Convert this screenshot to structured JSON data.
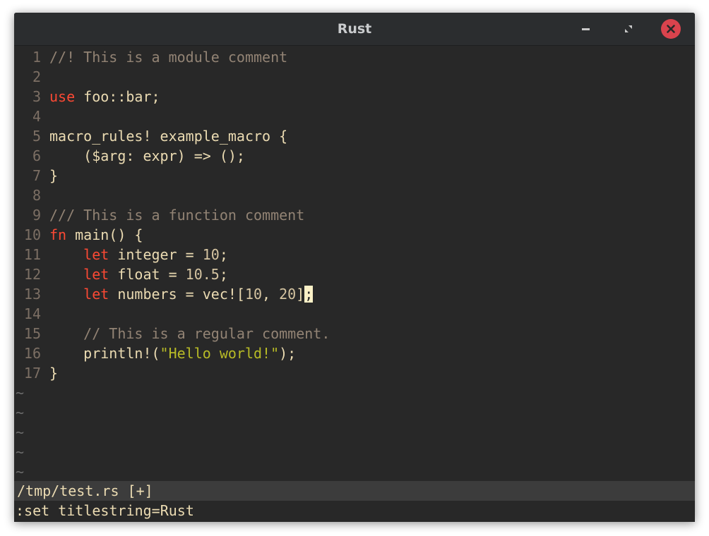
{
  "window": {
    "title": "Rust",
    "close_color": "#d9434d"
  },
  "editor": {
    "lines": [
      {
        "num": "1",
        "segments": [
          {
            "t": "//! This is a module comment",
            "c": "cm"
          }
        ]
      },
      {
        "num": "2",
        "segments": []
      },
      {
        "num": "3",
        "segments": [
          {
            "t": "use",
            "c": "kw"
          },
          {
            "t": " foo::bar;",
            "c": ""
          }
        ]
      },
      {
        "num": "4",
        "segments": []
      },
      {
        "num": "5",
        "segments": [
          {
            "t": "macro_rules! example_macro {",
            "c": ""
          }
        ]
      },
      {
        "num": "6",
        "segments": [
          {
            "t": "    ($arg: expr) => ();",
            "c": ""
          }
        ]
      },
      {
        "num": "7",
        "segments": [
          {
            "t": "}",
            "c": ""
          }
        ]
      },
      {
        "num": "8",
        "segments": []
      },
      {
        "num": "9",
        "segments": [
          {
            "t": "/// This is a function comment",
            "c": "cm"
          }
        ]
      },
      {
        "num": "10",
        "segments": [
          {
            "t": "fn",
            "c": "kw"
          },
          {
            "t": " main() {",
            "c": ""
          }
        ]
      },
      {
        "num": "11",
        "segments": [
          {
            "t": "    ",
            "c": ""
          },
          {
            "t": "let",
            "c": "kw"
          },
          {
            "t": " integer = ",
            "c": ""
          },
          {
            "t": "10",
            "c": "numv"
          },
          {
            "t": ";",
            "c": ""
          }
        ]
      },
      {
        "num": "12",
        "segments": [
          {
            "t": "    ",
            "c": ""
          },
          {
            "t": "let",
            "c": "kw"
          },
          {
            "t": " float = ",
            "c": ""
          },
          {
            "t": "10.5",
            "c": "numv"
          },
          {
            "t": ";",
            "c": ""
          }
        ]
      },
      {
        "num": "13",
        "segments": [
          {
            "t": "    ",
            "c": ""
          },
          {
            "t": "let",
            "c": "kw"
          },
          {
            "t": " numbers = vec![",
            "c": ""
          },
          {
            "t": "10",
            "c": "numv"
          },
          {
            "t": ", ",
            "c": ""
          },
          {
            "t": "20",
            "c": "numv"
          },
          {
            "t": "]",
            "c": ""
          },
          {
            "t": ";",
            "c": "cursor"
          }
        ]
      },
      {
        "num": "14",
        "segments": []
      },
      {
        "num": "15",
        "segments": [
          {
            "t": "    ",
            "c": ""
          },
          {
            "t": "// This is a regular comment.",
            "c": "cm"
          }
        ]
      },
      {
        "num": "16",
        "segments": [
          {
            "t": "    println!(",
            "c": ""
          },
          {
            "t": "\"Hello world!\"",
            "c": "str"
          },
          {
            "t": ");",
            "c": ""
          }
        ]
      },
      {
        "num": "17",
        "segments": [
          {
            "t": "}",
            "c": ""
          }
        ]
      }
    ],
    "tildes": [
      "~",
      "~",
      "~",
      "~",
      "~"
    ]
  },
  "statusline": {
    "text": "/tmp/test.rs [+]"
  },
  "cmdline": {
    "text": ":set titlestring=Rust"
  }
}
